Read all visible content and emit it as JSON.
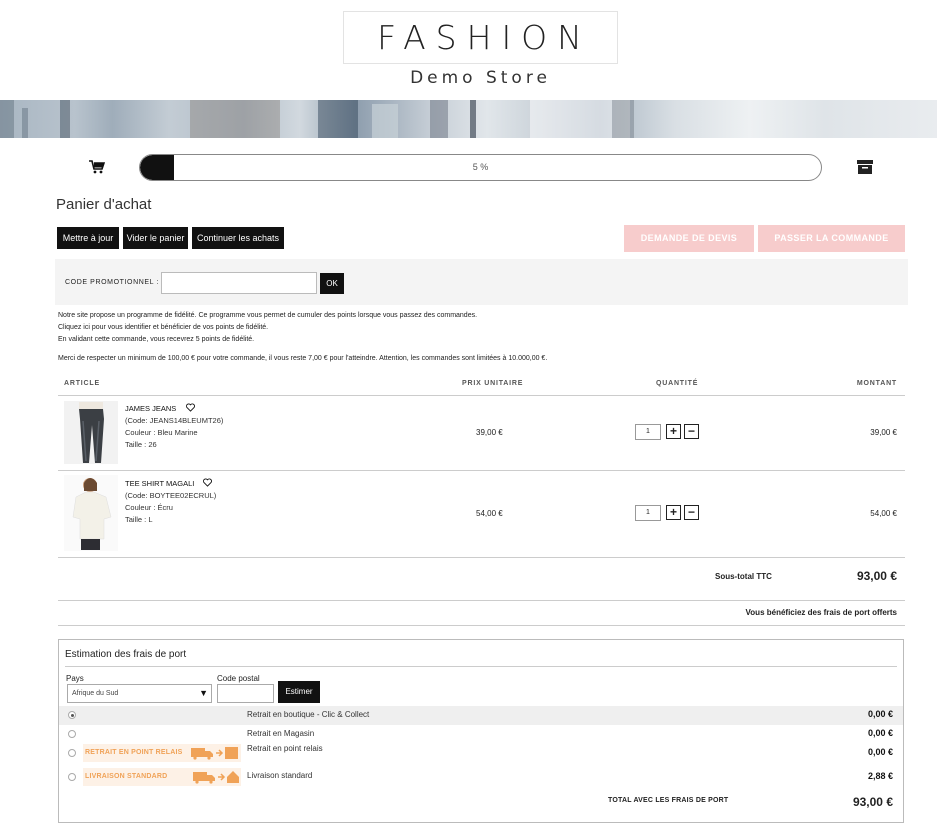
{
  "logo": {
    "line1": "FASHION",
    "line2": "Demo Store"
  },
  "progress": {
    "percent": 5,
    "label": "5 %"
  },
  "icons": {
    "cart": "cart-icon",
    "archive": "archive-box-icon",
    "heart": "heart-icon"
  },
  "page_title": "Panier d'achat",
  "actions": {
    "update": "Mettre à jour",
    "empty": "Vider le panier",
    "continue": "Continuer les achats",
    "quote": "DEMANDE DE DEVIS",
    "checkout": "PASSER LA COMMANDE"
  },
  "promo": {
    "label": "CODE PROMOTIONNEL :",
    "value": "",
    "ok": "OK"
  },
  "info": {
    "line1": "Notre site propose un programme de fidélité. Ce programme vous permet de cumuler des points lorsque vous passez des commandes.",
    "line2": "Cliquez ici pour vous identifier et bénéficier de vos points de fidélité.",
    "line3": "En validant cette commande, vous recevrez 5 points de fidélité.",
    "line4": "Merci de respecter un minimum de 100,00 € pour votre commande, il vous reste 7,00 € pour l'atteindre. Attention, les commandes sont limitées à 10.000,00 €."
  },
  "table": {
    "headers": {
      "article": "ARTICLE",
      "unit_price": "PRIX UNITAIRE",
      "quantity": "QUANTITÉ",
      "amount": "MONTANT"
    },
    "rows": [
      {
        "name": "JAMES JEANS",
        "code": "(Code: JEANS14BLEUMT26)",
        "color": "Couleur : Bleu Marine",
        "size": "Taille : 26",
        "price": "39,00 €",
        "qty": "1",
        "amount": "39,00 €"
      },
      {
        "name": "TEE SHIRT MAGALI",
        "code": "(Code: BOYTEE02ECRUL)",
        "color": "Couleur : Écru",
        "size": "Taille : L",
        "price": "54,00 €",
        "qty": "1",
        "amount": "54,00 €"
      }
    ]
  },
  "qty_plus": "+",
  "qty_minus": "−",
  "subtotal": {
    "label": "Sous-total TTC",
    "value": "93,00 €"
  },
  "free_shipping": "Vous bénéficiez des frais de port offerts",
  "shipping": {
    "title": "Estimation des frais de port",
    "country_label": "Pays",
    "country_value": "Afrique du Sud",
    "postal_label": "Code postal",
    "postal_value": "",
    "estimate": "Estimer",
    "options": [
      {
        "badge": "",
        "name": "Retrait en boutique - Clic & Collect",
        "price": "0,00 €",
        "selected": true
      },
      {
        "badge": "",
        "name": "Retrait en Magasin",
        "price": "0,00 €",
        "selected": false
      },
      {
        "badge": "RETRAIT EN POINT RELAIS",
        "name": "Retrait en point relais",
        "price": "0,00 €",
        "selected": false
      },
      {
        "badge": "LIVRAISON STANDARD",
        "name": "Livraison standard",
        "price": "2,88 €",
        "selected": false
      }
    ],
    "total_label": "TOTAL AVEC LES FRAIS DE PORT",
    "total_value": "93,00 €"
  },
  "colors": {
    "accent_pink": "#f7cccc",
    "dark": "#111111",
    "badge_orange": "#f0a257"
  }
}
